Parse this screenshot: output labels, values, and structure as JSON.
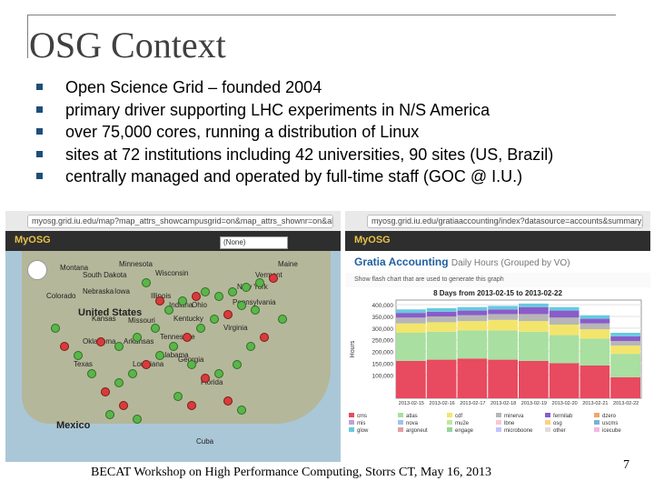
{
  "slide": {
    "title": "OSG Context",
    "bullets": [
      "Open Science Grid – founded 2004",
      "primary driver supporting LHC experiments in N/S America",
      "over 75,000 cores, running a distribution of Linux",
      "sites at 72 institutions including 42 universities, 90 sites (US, Brazil)",
      "centrally managed and operated by full-time staff (GOC @ I.U.)"
    ],
    "footer": "BECAT Workshop on High Performance Computing, Storrs CT, May 16, 2013",
    "page_number": "7"
  },
  "left_screenshot": {
    "url": "myosg.grid.iu.edu/map?map_attrs_showcampusgrid=on&map_attrs_shownr=on&all_sites",
    "logo": "MyOSG",
    "filter_value": "(None)",
    "map_labels": [
      "United States",
      "Mexico",
      "Cuba",
      "Montana",
      "Minnesota",
      "Wisconsin",
      "Illinois",
      "Kansas",
      "Missouri",
      "Arkansas",
      "Oklahoma",
      "Texas",
      "Georgia",
      "Florida",
      "Kentucky",
      "Virginia",
      "Vermont",
      "Maine",
      "New York",
      "Pennsylvania",
      "Colorado",
      "Nebraska",
      "South Dakota",
      "Iowa",
      "Tennessee",
      "Alabama",
      "Louisiana",
      "Ohio",
      "Indiana"
    ],
    "colors": {
      "site_green": "#5bb54a",
      "site_red": "#d83b3b",
      "land": "#b5b79a",
      "water": "#aac7d8"
    }
  },
  "right_screenshot": {
    "url": "myosg.grid.iu.edu/gratiaaccounting/index?datasource=accounts&summary_site&showsource",
    "logo": "MyOSG",
    "heading": "Gratia Accounting",
    "subheading": "Daily Hours (Grouped by VO)",
    "option_text": "Show flash chart that are used to generate this graph"
  },
  "chart_data": {
    "type": "bar",
    "title": "8 Days from 2013-02-15 to 2013-02-22",
    "ylabel": "Hours",
    "ylim": [
      0,
      420000
    ],
    "yticks": [
      "100,000",
      "150,000",
      "200,000",
      "250,000",
      "300,000",
      "350,000",
      "400,000"
    ],
    "categories": [
      "2013-02-15",
      "2013-02-16",
      "2013-02-17",
      "2013-02-18",
      "2013-02-19",
      "2013-02-20",
      "2013-02-21",
      "2013-02-22"
    ],
    "series": [
      {
        "name": "cms",
        "color": "#e84a5f",
        "values": [
          160000,
          165000,
          170000,
          165000,
          160000,
          150000,
          140000,
          90000
        ]
      },
      {
        "name": "atlas",
        "color": "#a9dfa0",
        "values": [
          120000,
          120000,
          120000,
          125000,
          125000,
          120000,
          115000,
          100000
        ]
      },
      {
        "name": "cdf",
        "color": "#f3e56c",
        "values": [
          40000,
          40000,
          40000,
          45000,
          45000,
          45000,
          40000,
          35000
        ]
      },
      {
        "name": "minerva",
        "color": "#b6b6b6",
        "values": [
          25000,
          25000,
          25000,
          25000,
          30000,
          30000,
          25000,
          20000
        ]
      },
      {
        "name": "fermilab",
        "color": "#8a5cc9",
        "values": [
          20000,
          20000,
          20000,
          20000,
          30000,
          30000,
          20000,
          20000
        ]
      },
      {
        "name": "glow",
        "color": "#68c9e0",
        "values": [
          15000,
          15000,
          15000,
          15000,
          15000,
          15000,
          15000,
          15000
        ]
      }
    ],
    "legend": [
      "cms",
      "atlas",
      "cdf",
      "minerva",
      "fermilab",
      "dzero",
      "mis",
      "nova",
      "mu2e",
      "lbne",
      "osg",
      "uscms",
      "glow",
      "argoneut",
      "engage",
      "microboone",
      "other",
      "icecube"
    ],
    "legend_colors": [
      "#e84a5f",
      "#a9dfa0",
      "#f3e56c",
      "#b6b6b6",
      "#8a5cc9",
      "#f0a868",
      "#c59fd6",
      "#9ec2f0",
      "#c0e79b",
      "#f7c9d3",
      "#ffd27a",
      "#7bb0d6",
      "#68c9e0",
      "#e3a0a0",
      "#95d59b",
      "#c3c3ff",
      "#dddddd",
      "#f5b6e0"
    ]
  }
}
